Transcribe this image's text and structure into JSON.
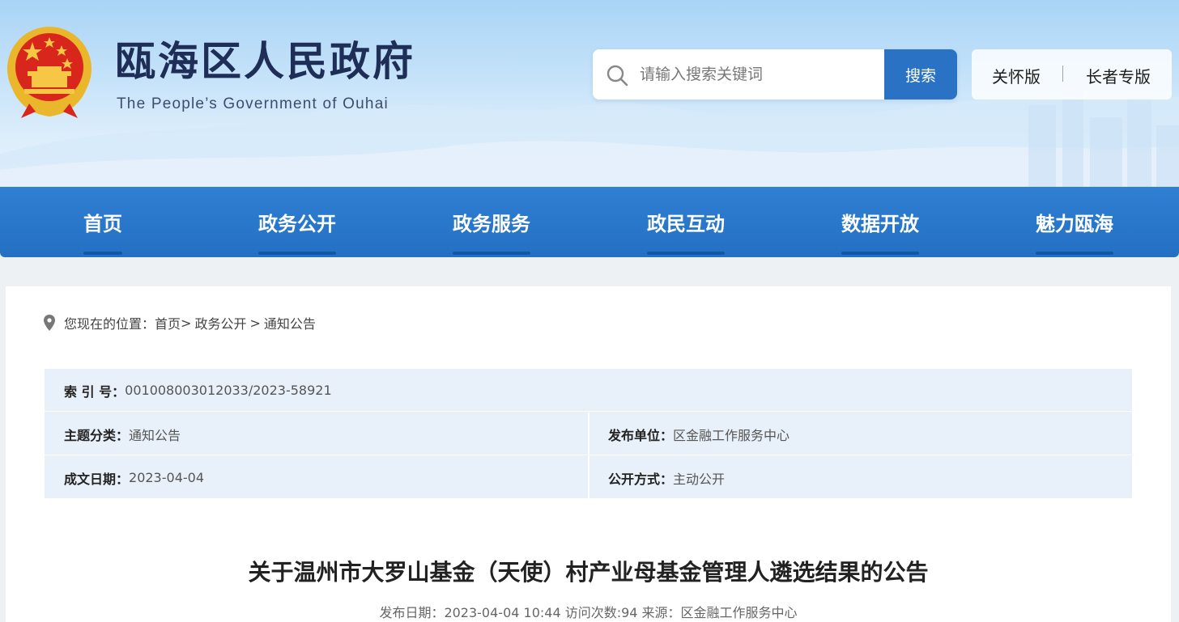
{
  "header": {
    "title": "瓯海区人民政府",
    "subtitle": "The People’s Government of Ouhai",
    "search": {
      "placeholder": "请输入搜索关键词",
      "button_label": "搜索"
    },
    "modes": {
      "care": "关怀版",
      "separator": "|",
      "elder": "长者专版"
    }
  },
  "nav": {
    "items": [
      {
        "label": "首页"
      },
      {
        "label": "政务公开"
      },
      {
        "label": "政务服务"
      },
      {
        "label": "政民互动"
      },
      {
        "label": "数据开放"
      },
      {
        "label": "魅力瓯海"
      }
    ]
  },
  "breadcrumb": {
    "prefix": "您现在的位置：",
    "items": [
      "首页",
      "政务公开",
      "通知公告"
    ],
    "separators": [
      ">",
      ">"
    ]
  },
  "meta": {
    "index_label": "索 引 号：",
    "index_value": "001008003012033/2023-58921",
    "topic_label": "主题分类：",
    "topic_value": "通知公告",
    "publisher_label": "发布单位：",
    "publisher_value": "区金融工作服务中心",
    "date_label": "成文日期：",
    "date_value": "2023-04-04",
    "method_label": "公开方式：",
    "method_value": "主动公开"
  },
  "article": {
    "title": "关于温州市大罗山基金（天使）村产业母基金管理人遴选结果的公告",
    "meta_line": "发布日期：2023-04-04 10:44 访问次数:94 来源：区金融工作服务中心"
  },
  "colors": {
    "nav_blue": "#2673c6",
    "search_button": "#2a72c4",
    "title_navy": "#1e2e56",
    "meta_bg": "#e8f0f9"
  },
  "icons": {
    "emblem": "national-emblem-icon",
    "search": "search-icon",
    "location": "location-pin-icon"
  }
}
